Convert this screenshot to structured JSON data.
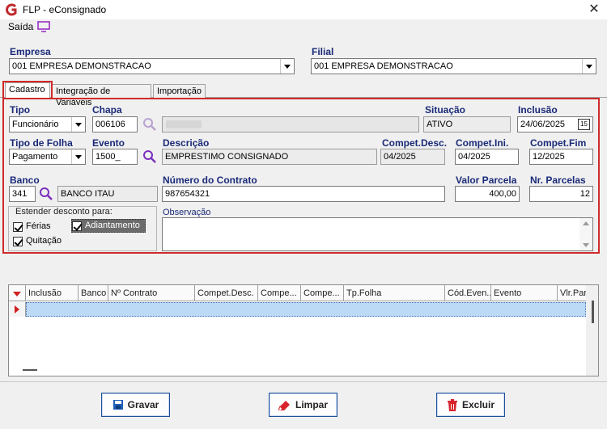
{
  "window": {
    "title": "FLP - eConsignado",
    "close_glyph": "✕"
  },
  "menu": {
    "saida": "Saída"
  },
  "empresa": {
    "label": "Empresa",
    "value": "001 EMPRESA DEMONSTRACAO"
  },
  "filial": {
    "label": "Filial",
    "value": "001 EMPRESA DEMONSTRACAO"
  },
  "tabs": [
    {
      "label": "Cadastro"
    },
    {
      "label": "Integração de Variáveis"
    },
    {
      "label": "Importação"
    }
  ],
  "form": {
    "tipo": {
      "label": "Tipo",
      "value": "Funcionário"
    },
    "chapa": {
      "label": "Chapa",
      "value": "006106",
      "name_value": ""
    },
    "situacao": {
      "label": "Situação",
      "value": "ATIVO"
    },
    "inclusao": {
      "label": "Inclusão",
      "value": "24/06/2025",
      "calendar_glyph": "15"
    },
    "tipo_folha": {
      "label": "Tipo de Folha",
      "value": "Pagamento"
    },
    "evento": {
      "label": "Evento",
      "value": "1500_"
    },
    "descricao": {
      "label": "Descrição",
      "value": "EMPRESTIMO CONSIGNADO"
    },
    "compet_desc": {
      "label": "Compet.Desc.",
      "value": "04/2025"
    },
    "compet_ini": {
      "label": "Compet.Ini.",
      "value": "04/2025"
    },
    "compet_fim": {
      "label": "Compet.Fim",
      "value": "12/2025"
    },
    "banco": {
      "label": "Banco",
      "code": "341",
      "name": "BANCO ITAU"
    },
    "numero_contrato": {
      "label": "Número do Contrato",
      "value": "987654321"
    },
    "valor_parcela": {
      "label": "Valor Parcela",
      "value": "400,00"
    },
    "nr_parcelas": {
      "label": "Nr. Parcelas",
      "value": "12"
    },
    "estender": {
      "label": "Estender desconto para:",
      "ferias": {
        "label": "Férias",
        "checked": true
      },
      "adiantamento": {
        "label": "Adiantamento",
        "checked": true
      },
      "quitacao": {
        "label": "Quitação",
        "checked": true
      }
    },
    "observacao": {
      "label": "Observação",
      "value": ""
    }
  },
  "grid": {
    "columns": [
      "Inclusão",
      "Banco",
      "Nº Contrato",
      "Compet.Desc.",
      "Compe...",
      "Compe...",
      "Tp.Folha",
      "Cód.Even...",
      "Evento",
      "Vlr.Par"
    ]
  },
  "buttons": {
    "gravar": "Gravar",
    "limpar": "Limpar",
    "excluir": "Excluir"
  },
  "colors": {
    "label_blue": "#1a2a78",
    "highlight_red": "#d02a2a",
    "selected_row": "#bcd9f5",
    "button_border": "#1f4e9a",
    "search_icon": "#7a2fbf"
  }
}
